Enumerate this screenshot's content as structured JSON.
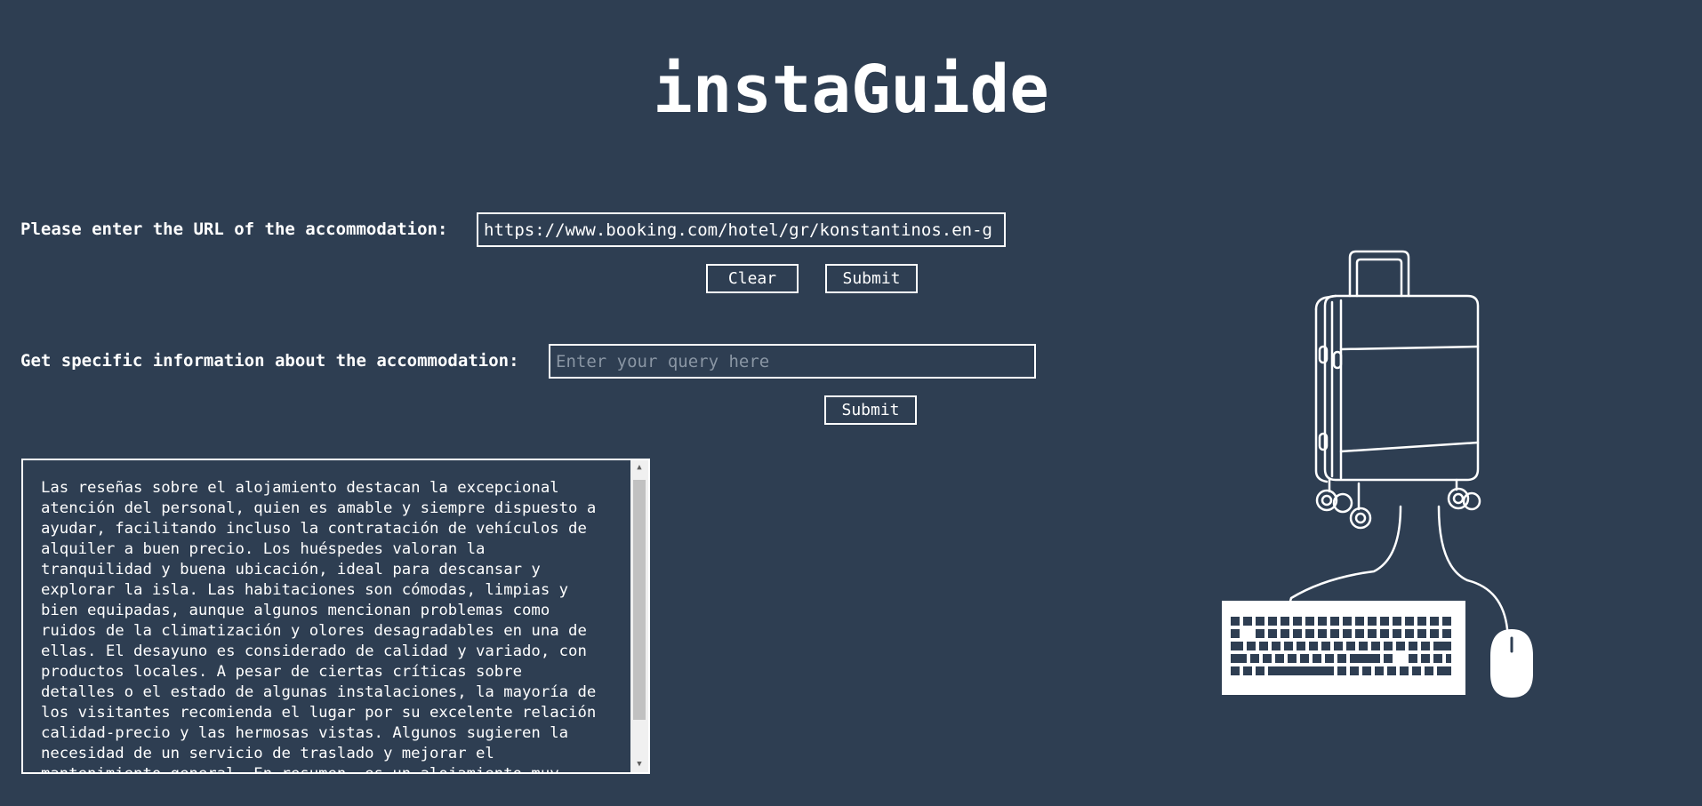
{
  "app": {
    "title": "instaGuide"
  },
  "url_section": {
    "label": "Please enter the URL of the accommodation:",
    "input_value": "https://www.booking.com/hotel/gr/konstantinos.en-g",
    "clear_label": "Clear",
    "submit_label": "Submit"
  },
  "query_section": {
    "label": "Get specific information about the accommodation:",
    "placeholder": "Enter your query here",
    "submit_label": "Submit"
  },
  "result": {
    "text": "Las reseñas sobre el alojamiento destacan la excepcional\natención del personal, quien es amable y siempre dispuesto a\nayudar, facilitando incluso la contratación de vehículos de\nalquiler a buen precio. Los huéspedes valoran la\ntranquilidad y buena ubicación, ideal para descansar y\nexplorar la isla. Las habitaciones son cómodas, limpias y\nbien equipadas, aunque algunos mencionan problemas como\nruidos de la climatización y olores desagradables en una de\nellas. El desayuno es considerado de calidad y variado, con\nproductos locales. A pesar de ciertas críticas sobre\ndetalles o el estado de algunas instalaciones, la mayoría de\nlos visitantes recomienda el lugar por su excelente relación\ncalidad-precio y las hermosas vistas. Algunos sugieren la\nnecesidad de un servicio de traslado y mejorar el\nmantenimiento general. En resumen, es un alojamiento muy"
  },
  "icons": {
    "illustration": "suitcase-keyboard-mouse-illustration",
    "scroll_up": "▲",
    "scroll_down": "▼"
  },
  "colors": {
    "background": "#2e3e52",
    "foreground": "#ffffff"
  }
}
